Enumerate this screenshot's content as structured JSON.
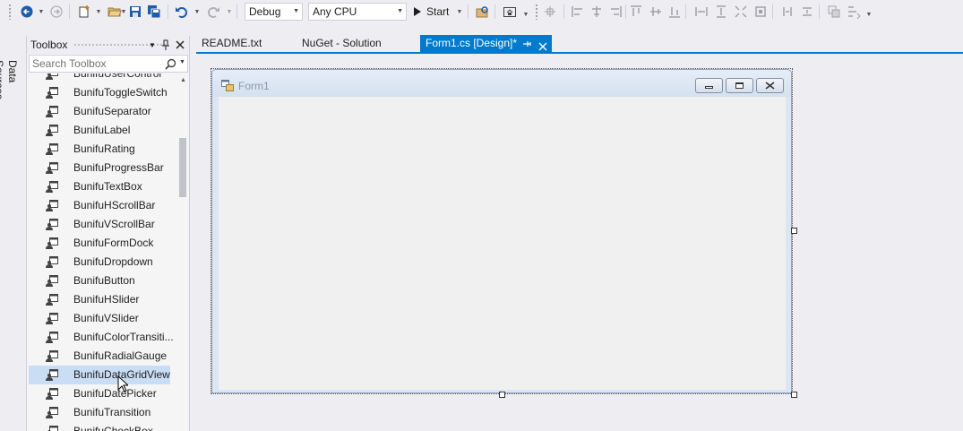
{
  "toolbar": {
    "config_value": "Debug",
    "platform_value": "Any CPU",
    "start_label": "Start"
  },
  "left_strip": {
    "data_sources_label": "Data Sources"
  },
  "toolbox": {
    "title": "Toolbox",
    "search_placeholder": "Search Toolbox",
    "items": [
      {
        "label": "BunifuUserControl"
      },
      {
        "label": "BunifuToggleSwitch"
      },
      {
        "label": "BunifuSeparator"
      },
      {
        "label": "BunifuLabel"
      },
      {
        "label": "BunifuRating"
      },
      {
        "label": "BunifuProgressBar"
      },
      {
        "label": "BunifuTextBox"
      },
      {
        "label": "BunifuHScrollBar"
      },
      {
        "label": "BunifuVScrollBar"
      },
      {
        "label": "BunifuFormDock"
      },
      {
        "label": "BunifuDropdown"
      },
      {
        "label": "BunifuButton"
      },
      {
        "label": "BunifuHSlider"
      },
      {
        "label": "BunifuVSlider"
      },
      {
        "label": "BunifuColorTransiti..."
      },
      {
        "label": "BunifuRadialGauge"
      },
      {
        "label": "BunifuDataGridView"
      },
      {
        "label": "BunifuDatePicker"
      },
      {
        "label": "BunifuTransition"
      },
      {
        "label": "BunifuCheckBox"
      }
    ],
    "selected_index": 16
  },
  "tabs": [
    {
      "label": "README.txt"
    },
    {
      "label": "NuGet - Solution"
    },
    {
      "label": "Form1.cs [Design]*"
    }
  ],
  "form": {
    "title": "Form1"
  },
  "colors": {
    "accent": "#007acc",
    "selection": "#c9def5"
  }
}
